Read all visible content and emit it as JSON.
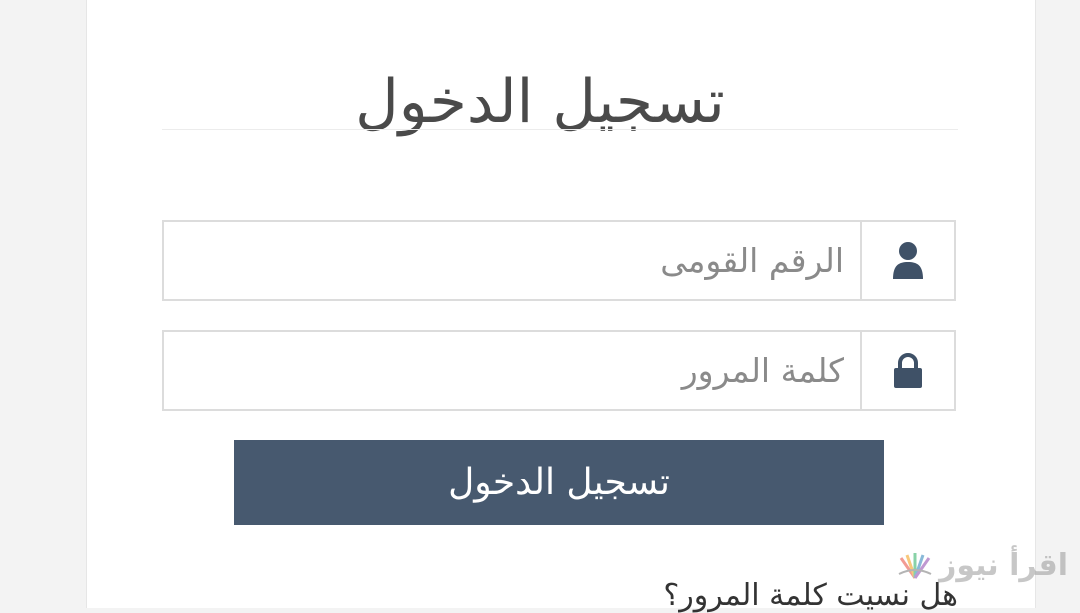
{
  "login": {
    "title": "تسجيل الدخول",
    "national_id": {
      "placeholder": "الرقم القومى",
      "value": "",
      "icon": "user-icon"
    },
    "password": {
      "placeholder": "كلمة المرور",
      "value": "",
      "icon": "lock-icon"
    },
    "submit_label": "تسجيل الدخول",
    "forgot_password": "هل نسيت كلمة المرور؟"
  },
  "watermark": {
    "text": "اقرأ نيوز"
  },
  "colors": {
    "button": "#47596f",
    "icon": "#3f5167",
    "border": "#dcdcdc",
    "title": "#4a4a4a"
  }
}
